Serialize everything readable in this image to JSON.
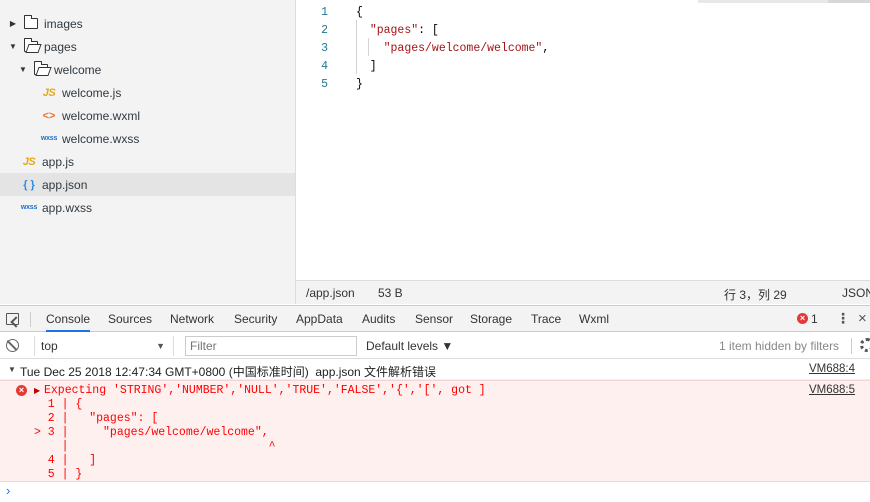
{
  "tree": {
    "items": [
      {
        "label": "images",
        "kind": "folder",
        "expanded": false,
        "depth": 0
      },
      {
        "label": "pages",
        "kind": "folder",
        "expanded": true,
        "depth": 0
      },
      {
        "label": "welcome",
        "kind": "folder",
        "expanded": true,
        "depth": 1
      },
      {
        "label": "welcome.js",
        "kind": "js",
        "depth": 2
      },
      {
        "label": "welcome.wxml",
        "kind": "wxml",
        "depth": 2
      },
      {
        "label": "welcome.wxss",
        "kind": "wxss",
        "depth": 2
      },
      {
        "label": "app.js",
        "kind": "js",
        "depth": 0
      },
      {
        "label": "app.json",
        "kind": "json",
        "depth": 0,
        "selected": true
      },
      {
        "label": "app.wxss",
        "kind": "wxss",
        "depth": 0
      }
    ],
    "icon_glyphs": {
      "js": "JS",
      "wxml": "<>",
      "wxss": "wxss",
      "json": "{ }"
    }
  },
  "editor": {
    "lines": [
      {
        "num": "1",
        "text": "{"
      },
      {
        "num": "2",
        "text": "  \"pages\": ["
      },
      {
        "num": "3",
        "text": "    \"pages/welcome/welcome\","
      },
      {
        "num": "4",
        "text": "  ]"
      },
      {
        "num": "5",
        "text": "}"
      }
    ]
  },
  "statusbar": {
    "path": "/app.json",
    "size": "53 B",
    "cursor": "行 3，列 29",
    "language": "JSON"
  },
  "devtools": {
    "tabs": [
      "Console",
      "Sources",
      "Network",
      "Security",
      "AppData",
      "Audits",
      "Sensor",
      "Storage",
      "Trace",
      "Wxml"
    ],
    "active_tab": "Console",
    "error_count": "1",
    "error_icon_glyph": "×",
    "kebab_glyph": "⋮",
    "close_glyph": "×"
  },
  "console_toolbar": {
    "context": "top",
    "context_caret": "▼",
    "filter_placeholder": "Filter",
    "levels": "Default levels ▼",
    "hidden_info": "1 item hidden by filters"
  },
  "console": {
    "group_text": "Tue Dec 25 2018 12:47:34 GMT+0800 (中国标准时间)  app.json 文件解析错误",
    "group_source": "VM688:4",
    "error_source": "VM688:5",
    "error_lines": [
      "Expecting 'STRING','NUMBER','NULL','TRUE','FALSE','{','[', got ]",
      "  1 | {",
      "  2 |   \"pages\": [",
      "> 3 |     \"pages/welcome/welcome\",",
      "    |                             ^",
      "  4 |   ]",
      "  5 | }"
    ],
    "prompt_glyph": "›"
  },
  "colors": {
    "accent": "#1a73e8",
    "error": "#e53935",
    "error_bg": "#fff0f0",
    "string": "#a31515",
    "line_number": "#237893"
  }
}
